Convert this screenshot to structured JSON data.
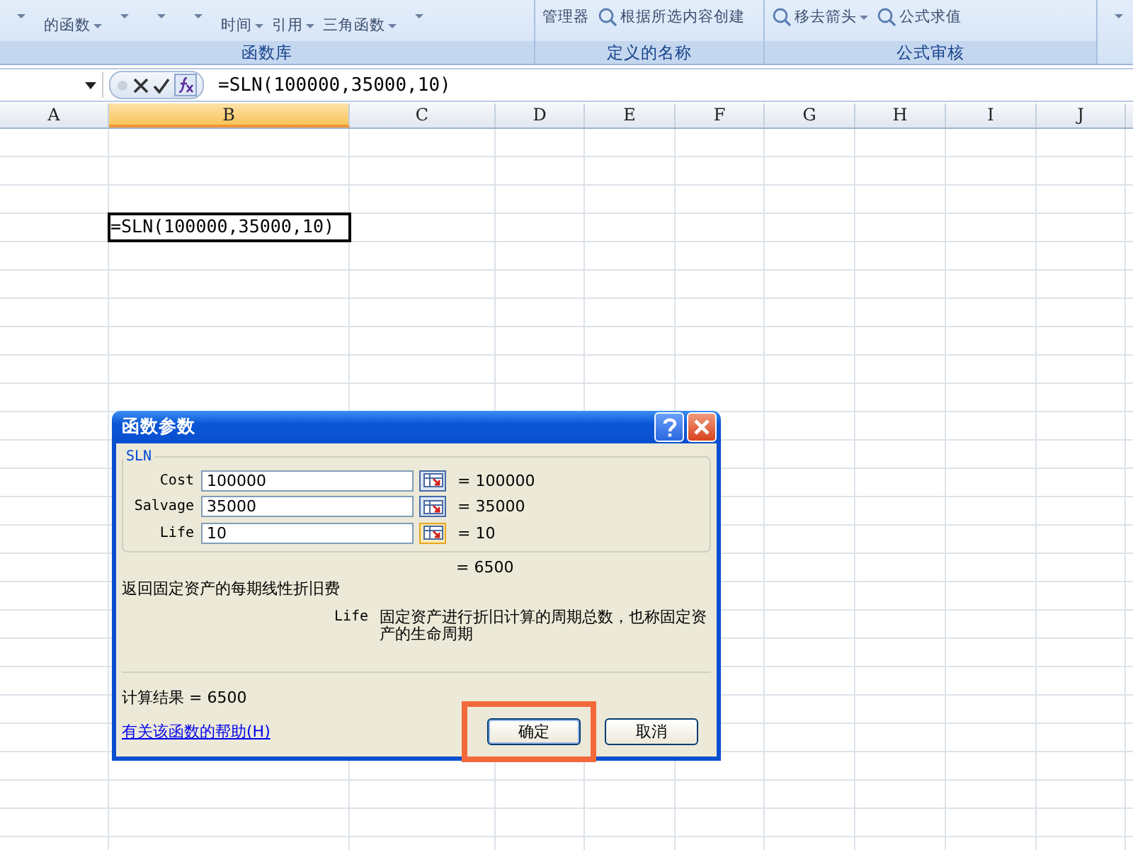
{
  "ribbon": {
    "groups": [
      {
        "label": "函数库",
        "items": [
          {
            "kind": "caret"
          },
          {
            "kind": "text",
            "label": "的函数",
            "dropdown": true
          },
          {
            "kind": "caret"
          },
          {
            "kind": "caret"
          },
          {
            "kind": "caret"
          },
          {
            "kind": "text",
            "label": "时间",
            "dropdown": true
          },
          {
            "kind": "text",
            "label": "引用",
            "dropdown": true
          },
          {
            "kind": "text",
            "label": "三角函数",
            "dropdown": true
          },
          {
            "kind": "caret"
          }
        ]
      },
      {
        "label": "定义的名称",
        "items": [
          {
            "kind": "text",
            "label": "管理器",
            "dropdown": false
          },
          {
            "kind": "icon-text",
            "label": "根据所选内容创建",
            "dropdown": false
          }
        ]
      },
      {
        "label": "公式审核",
        "items": [
          {
            "kind": "icon-text",
            "label": "移去箭头",
            "dropdown": true
          },
          {
            "kind": "icon-text",
            "label": "公式求值",
            "dropdown": false
          }
        ]
      },
      {
        "items": [
          {
            "kind": "caret"
          }
        ]
      }
    ]
  },
  "formula_bar": {
    "formula": "=SLN(100000,35000,10)"
  },
  "sheet": {
    "columns": [
      {
        "label": "A",
        "selected": false
      },
      {
        "label": "B",
        "selected": true
      },
      {
        "label": "C",
        "selected": false
      },
      {
        "label": "D",
        "selected": false
      },
      {
        "label": "E",
        "selected": false
      },
      {
        "label": "F",
        "selected": false
      },
      {
        "label": "G",
        "selected": false
      },
      {
        "label": "H",
        "selected": false
      },
      {
        "label": "I",
        "selected": false
      },
      {
        "label": "J",
        "selected": false
      }
    ],
    "active_cell": {
      "text": "=SLN(100000,35000,10)"
    }
  },
  "dialog": {
    "title": "函数参数",
    "function_name": "SLN",
    "arguments": [
      {
        "label": "Cost",
        "value": "100000",
        "result": "= 100000",
        "selected": false
      },
      {
        "label": "Salvage",
        "value": "35000",
        "result": "= 35000",
        "selected": false
      },
      {
        "label": "Life",
        "value": "10",
        "result": "= 10",
        "selected": true
      }
    ],
    "formula_result": "= 6500",
    "description": "返回固定资产的每期线性折旧费",
    "argument_help": {
      "name": "Life",
      "text": "固定资产进行折旧计算的周期总数，也称固定资产的生命周期"
    },
    "calc_result": "计算结果 =  6500",
    "help_link": "有关该函数的帮助(H)",
    "buttons": [
      {
        "label": "确定",
        "default": true,
        "highlighted": true
      },
      {
        "label": "取消",
        "default": false,
        "highlighted": false
      }
    ]
  }
}
